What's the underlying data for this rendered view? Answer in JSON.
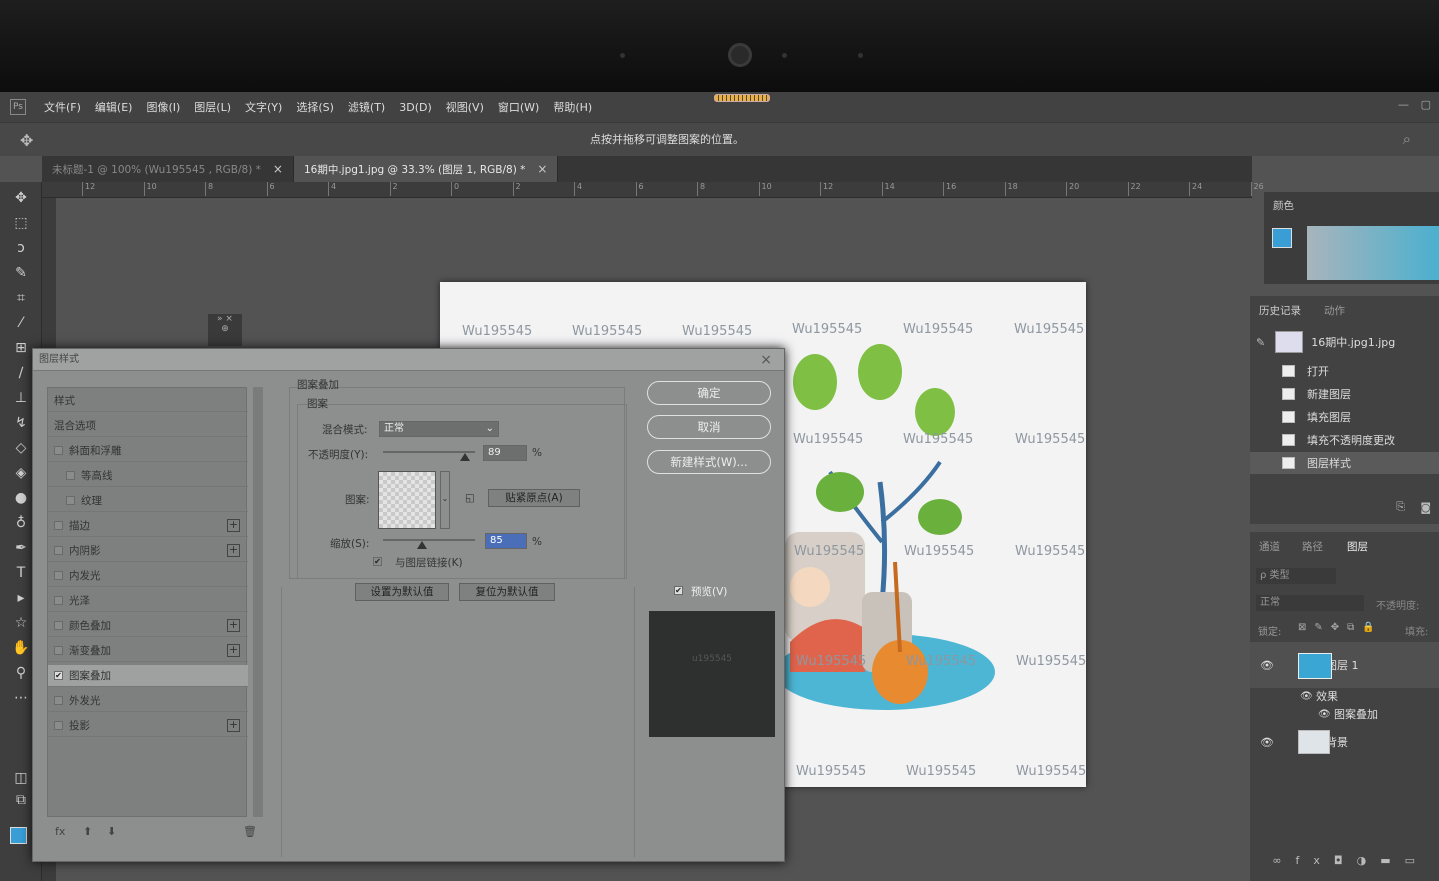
{
  "menubar": {
    "logo": "Ps",
    "items": [
      "文件(F)",
      "编辑(E)",
      "图像(I)",
      "图层(L)",
      "文字(Y)",
      "选择(S)",
      "滤镜(T)",
      "3D(D)",
      "视图(V)",
      "窗口(W)",
      "帮助(H)"
    ]
  },
  "options": {
    "hint": "点按并拖移可调整图案的位置。"
  },
  "tabs": [
    {
      "label": "未标题-1 @ 100% (Wu195545 , RGB/8) *",
      "close": "×"
    },
    {
      "label": "16期中.jpg1.jpg @ 33.3% (图层 1, RGB/8) *",
      "close": "×"
    }
  ],
  "ruler_ticks": [
    "12",
    "10",
    "8",
    "6",
    "4",
    "2",
    "0",
    "2",
    "4",
    "6",
    "8",
    "10",
    "12",
    "14",
    "16",
    "18",
    "20",
    "22",
    "24",
    "26"
  ],
  "watermark": "Wu195545",
  "mini_panel": {
    "top": "» ×",
    "icon": "⊕"
  },
  "dialog": {
    "title": "图层样式",
    "close": "×",
    "styles": [
      {
        "label": "样式",
        "check": false,
        "plus": false,
        "indent": 0
      },
      {
        "label": "混合选项",
        "check": false,
        "plus": false,
        "indent": 0
      },
      {
        "label": "斜面和浮雕",
        "check": true,
        "plus": false,
        "indent": 0
      },
      {
        "label": "等高线",
        "check": true,
        "plus": false,
        "indent": 1
      },
      {
        "label": "纹理",
        "check": true,
        "plus": false,
        "indent": 1
      },
      {
        "label": "描边",
        "check": true,
        "plus": true,
        "indent": 0
      },
      {
        "label": "内阴影",
        "check": true,
        "plus": true,
        "indent": 0
      },
      {
        "label": "内发光",
        "check": true,
        "plus": false,
        "indent": 0
      },
      {
        "label": "光泽",
        "check": true,
        "plus": false,
        "indent": 0
      },
      {
        "label": "颜色叠加",
        "check": true,
        "plus": true,
        "indent": 0
      },
      {
        "label": "渐变叠加",
        "check": true,
        "plus": true,
        "indent": 0
      },
      {
        "label": "图案叠加",
        "check": true,
        "plus": false,
        "indent": 0,
        "selected": true,
        "checked": true
      },
      {
        "label": "外发光",
        "check": true,
        "plus": false,
        "indent": 0
      },
      {
        "label": "投影",
        "check": true,
        "plus": true,
        "indent": 0
      }
    ],
    "footer": {
      "fx": "fx",
      "up": "⬆",
      "down": "⬇",
      "trash": "🗑"
    },
    "section_title": "图案叠加",
    "sub_title": "图案",
    "blend_label": "混合模式:",
    "blend_value": "正常",
    "opacity_label": "不透明度(Y):",
    "opacity_value": "89",
    "pct": "%",
    "pattern_label": "图案:",
    "snap_label": "贴紧原点(A)",
    "scale_label": "缩放(S):",
    "scale_value": "85",
    "link_label": "与图层链接(K)",
    "set_default": "设置为默认值",
    "reset_default": "复位为默认值",
    "ok": "确定",
    "cancel": "取消",
    "new_style": "新建样式(W)...",
    "preview_label": "预览(V)",
    "preview_text": "u195545",
    "opacity_fraction": 0.89,
    "scale_fraction": 0.42
  },
  "color_panel": {
    "title": "颜色"
  },
  "history": {
    "tabs": [
      "历史记录",
      "动作"
    ],
    "snapshot": "16期中.jpg1.jpg",
    "items": [
      "打开",
      "新建图层",
      "填充图层",
      "填充不透明度更改",
      "图层样式"
    ]
  },
  "layers": {
    "tabs": [
      "通道",
      "路径",
      "图层"
    ],
    "filter": "ρ 类型",
    "mode": "正常",
    "opacity_label": "不透明度:",
    "lock_label": "锁定:",
    "fill_label": "填充:",
    "layer1": "图层 1",
    "effects": "效果",
    "effect_item": "图案叠加",
    "background": "背景",
    "eye": "👁"
  },
  "colors": {
    "foreground": "#3a9ed6",
    "accent": "#4bb0cf"
  }
}
